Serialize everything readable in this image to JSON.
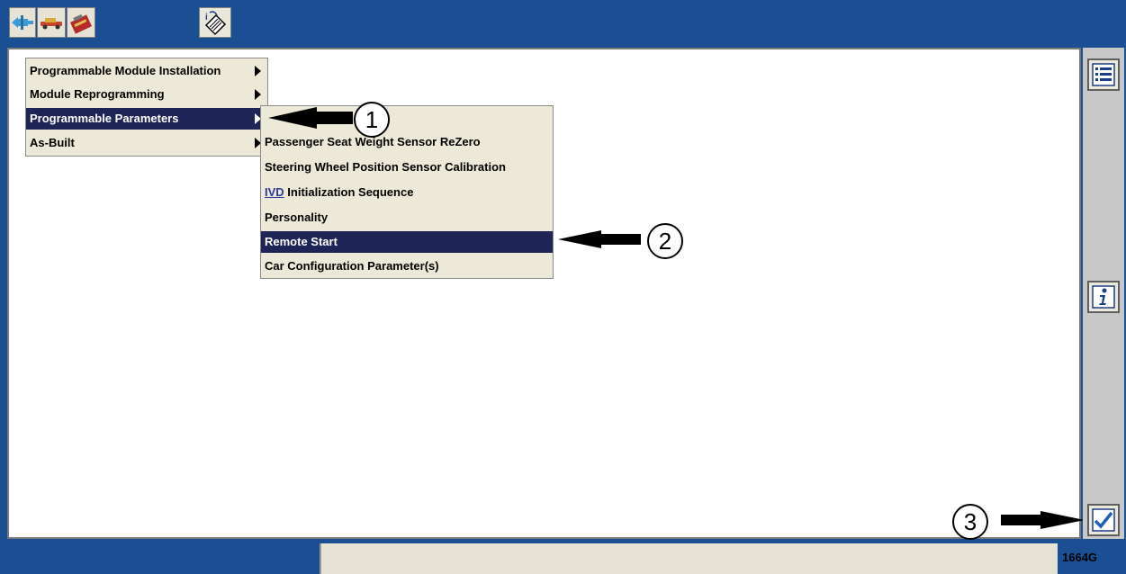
{
  "toolbar": {
    "icons": [
      "connector-icon",
      "vehicle-icon",
      "toolbox-icon",
      "info-book-icon"
    ]
  },
  "main_menu": {
    "items": [
      {
        "label": "Programmable Module Installation",
        "has_submenu": true,
        "selected": false
      },
      {
        "label": "Module Reprogramming",
        "has_submenu": true,
        "selected": false
      },
      {
        "label": "Programmable Parameters",
        "has_submenu": true,
        "selected": true
      },
      {
        "label": "As-Built",
        "has_submenu": true,
        "selected": false
      }
    ]
  },
  "submenu": {
    "items": [
      {
        "label": "Passenger Seat Weight Sensor ReZero",
        "selected": false
      },
      {
        "label": "Steering Wheel Position Sensor Calibration",
        "selected": false
      },
      {
        "prefix": "IVD",
        "label": "Initialization Sequence",
        "selected": false
      },
      {
        "label": "Personality",
        "selected": false
      },
      {
        "label": "Remote Start",
        "selected": true
      },
      {
        "label": "Car Configuration Parameter(s)",
        "selected": false
      }
    ]
  },
  "callouts": [
    "1",
    "2",
    "3"
  ],
  "side_buttons": [
    "list-icon",
    "info-icon",
    "checkmark-icon"
  ],
  "figure_code": "1664G",
  "colors": {
    "frame_blue": "#1b4f93",
    "selection_navy": "#1f2456",
    "menu_bg": "#ece9d8",
    "check_blue": "#1f5fb8"
  }
}
